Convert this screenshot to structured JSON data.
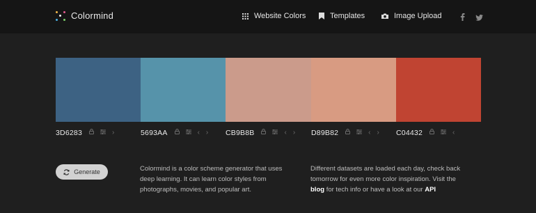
{
  "brand": {
    "name": "Colormind"
  },
  "nav": [
    {
      "label": "Website Colors",
      "icon": "grid-icon"
    },
    {
      "label": "Templates",
      "icon": "bookmark-icon"
    },
    {
      "label": "Image Upload",
      "icon": "camera-icon"
    }
  ],
  "social": [
    {
      "icon": "facebook-icon"
    },
    {
      "icon": "twitter-icon"
    }
  ],
  "palette": [
    {
      "hex": "3D6283",
      "color": "#3D6283"
    },
    {
      "hex": "5693AA",
      "color": "#5693AA"
    },
    {
      "hex": "CB9B8B",
      "color": "#CB9B8B"
    },
    {
      "hex": "D89B82",
      "color": "#D89B82"
    },
    {
      "hex": "C04432",
      "color": "#C04432"
    }
  ],
  "generate_label": "Generate",
  "about": {
    "text": "Colormind is a color scheme generator that uses deep learning. It can learn color styles from photographs, movies, and popular art."
  },
  "datasets": {
    "text_before": "Different datasets are loaded each day, check back tomorrow for even more color inspiration. Visit the",
    "blog_label": "blog",
    "text_middle": "for tech info or have a look at our",
    "api_label": "API"
  }
}
